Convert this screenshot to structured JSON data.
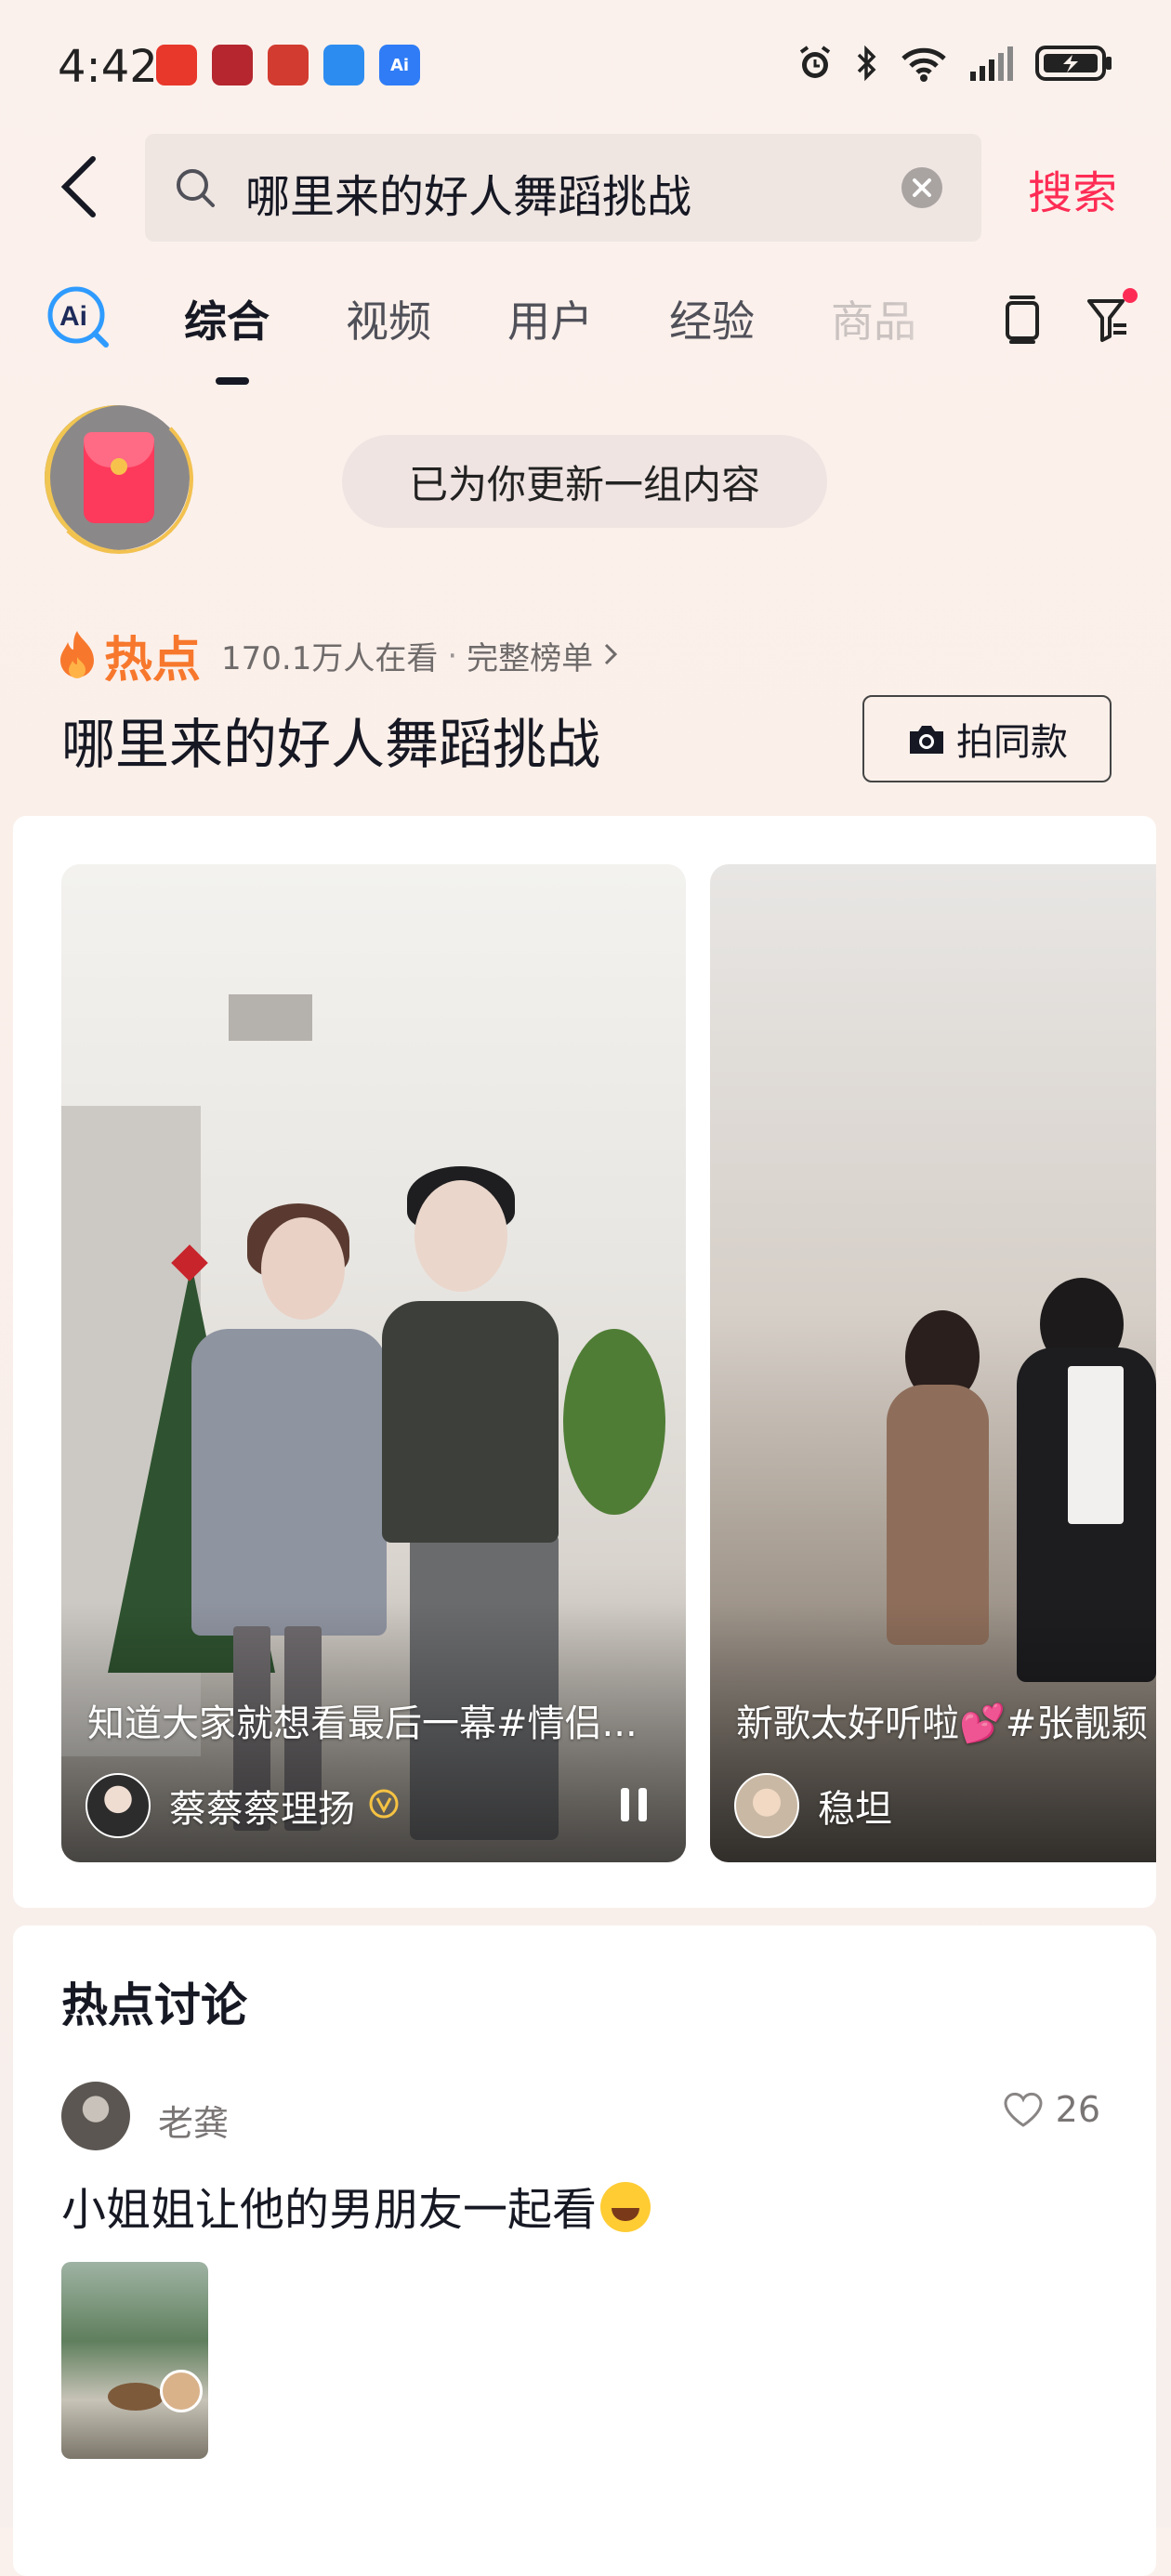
{
  "status_bar": {
    "time": "4:42",
    "apps": [
      {
        "icon": "red-app-icon",
        "color": "#e8372b"
      },
      {
        "icon": "news-app-icon",
        "color": "#b5262e"
      },
      {
        "icon": "game-app-icon",
        "color": "#d23b2f"
      },
      {
        "icon": "browser-app-icon",
        "color": "#2d8cf0"
      },
      {
        "icon": "ai-app-icon",
        "color": "#2f7cf6",
        "label": "Ai"
      }
    ]
  },
  "search": {
    "query": "哪里来的好人舞蹈挑战",
    "button_label": "搜索"
  },
  "tabs": [
    {
      "label": "综合",
      "active": true
    },
    {
      "label": "视频",
      "active": false
    },
    {
      "label": "用户",
      "active": false
    },
    {
      "label": "经验",
      "active": false
    },
    {
      "label": "商品",
      "active": false
    }
  ],
  "update_notice": "已为你更新一组内容",
  "hot": {
    "label": "热点",
    "watching": "170.1万人在看",
    "dot": "·",
    "full_list": "完整榜单",
    "title": "哪里来的好人舞蹈挑战",
    "shoot_same_label": "拍同款"
  },
  "videos": [
    {
      "caption": "知道大家就想看最后一幕#情侣...",
      "author": "蔡蔡蔡理扬",
      "verified": true,
      "playing": true
    },
    {
      "caption": "新歌太好听啦💕#张靓颖",
      "author": "稳坦",
      "verified": false,
      "playing": false
    }
  ],
  "discussion": {
    "title": "热点讨论",
    "user": "老龚",
    "likes": "26",
    "text": "小姐姐让他的男朋友一起看"
  },
  "colors": {
    "accent": "#fe2c55",
    "hot": "#f7782d",
    "text": "#161823"
  }
}
